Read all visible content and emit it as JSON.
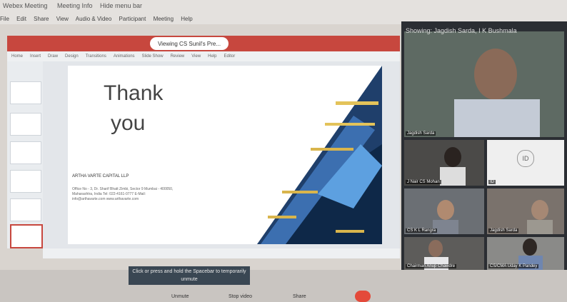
{
  "titlebar": {
    "app_title": "Webex Meeting",
    "meeting_info": "Meeting Info",
    "hide_menu_bar": "Hide menu bar"
  },
  "menubar": [
    "File",
    "Edit",
    "Share",
    "View",
    "Audio & Video",
    "Participant",
    "Meeting",
    "Help"
  ],
  "share": {
    "banner": "Viewing CS Sunil's Pre...",
    "toolbar_items": [
      "Home",
      "Insert",
      "Draw",
      "Design",
      "Transitions",
      "Animations",
      "Slide Show",
      "Review",
      "View",
      "Help",
      "Editor"
    ]
  },
  "slide": {
    "title_line1": "Thank",
    "title_line2": "you",
    "company": "ARTHA VARTE CAPITAL LLP",
    "address": "Office No - 3, Dr. Sharif Bhatt Zimbi, Sector 9 Mumbai - 400050, Maharashtra, India Tel: 022-4161-0777 E-Mail: info@arthavarte.com www.arthavarte.com"
  },
  "participants": {
    "panel_title": "Showing: Jagdish Sarda, I K Bushmala",
    "tiles": [
      {
        "name": "Jagdish Sarda"
      },
      {
        "name": "J Nair CS Mohan"
      },
      {
        "name": "ID",
        "initials": "ID"
      },
      {
        "name": "CS K L Rangra"
      },
      {
        "name": "Jagdish Sarda"
      },
      {
        "name": "Chairman Anup Chawdre"
      },
      {
        "name": "CS/CMA Uday K Pandey"
      }
    ]
  },
  "bottom": {
    "tooltip": "Click or press and hold the Spacebar to temporarily unmute",
    "unmute_label": "Unmute",
    "start_video_label": "Stop video",
    "share_label": "Share"
  }
}
